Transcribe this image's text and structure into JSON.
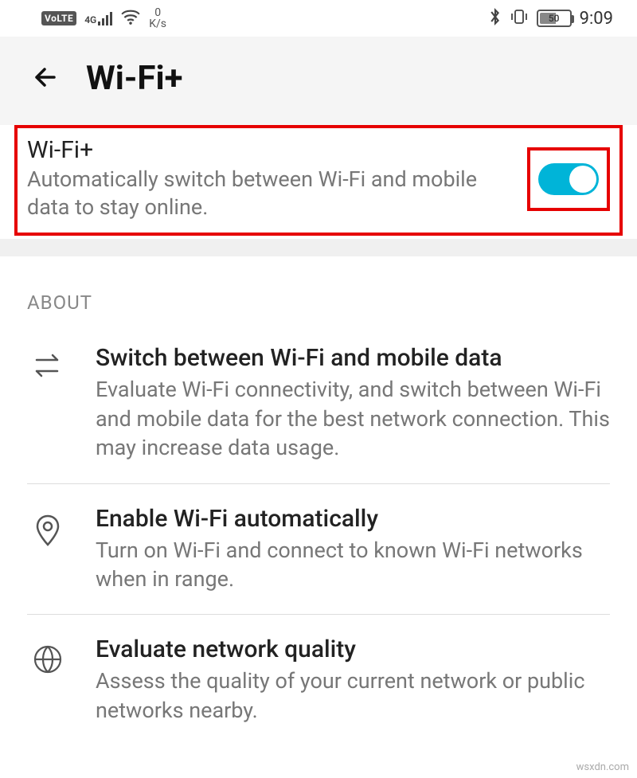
{
  "status": {
    "volte": "VoLTE",
    "network_label": "4G",
    "speed_num": "0",
    "speed_unit": "K/s",
    "battery": "50",
    "time": "9:09"
  },
  "header": {
    "title": "Wi-Fi+"
  },
  "main_toggle": {
    "title": "Wi-Fi+",
    "description": "Automatically switch between Wi-Fi and mobile data to stay online.",
    "enabled": true
  },
  "about": {
    "label": "ABOUT",
    "items": [
      {
        "title": "Switch between Wi-Fi and mobile data",
        "description": "Evaluate Wi-Fi connectivity, and switch between Wi-Fi and mobile data for the best network connection. This may increase data usage."
      },
      {
        "title": "Enable Wi-Fi automatically",
        "description": "Turn on Wi-Fi and connect to known Wi-Fi networks when in range."
      },
      {
        "title": "Evaluate network quality",
        "description": "Assess the quality of your current network or public networks nearby."
      }
    ]
  },
  "watermark": "wsxdn.com"
}
